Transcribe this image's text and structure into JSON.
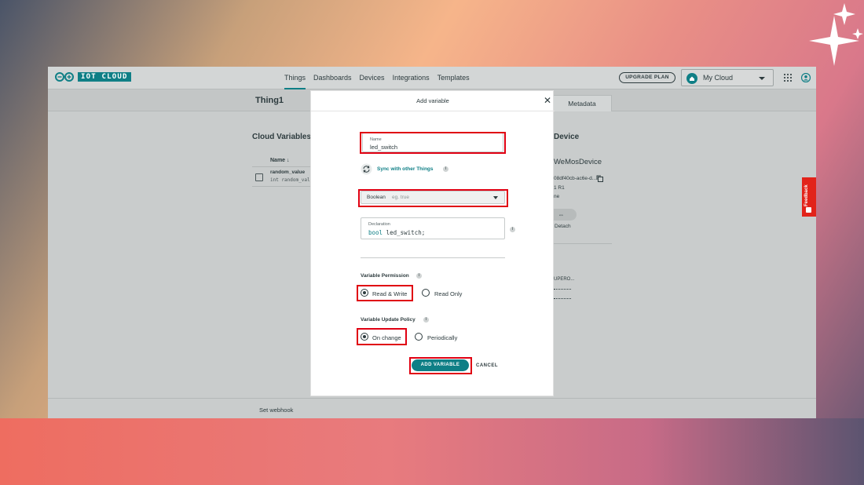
{
  "colors": {
    "accent": "#0f7f86",
    "highlight": "#e00012",
    "feedback": "#e2231a"
  },
  "brand": {
    "logo_text": "IOT CLOUD",
    "logo_icon": "arduino-infinity-icon"
  },
  "nav": {
    "items": [
      "Things",
      "Dashboards",
      "Devices",
      "Integrations",
      "Templates"
    ],
    "active": "Things"
  },
  "header": {
    "upgrade_label": "UPGRADE PLAN",
    "cloud_label": "My Cloud"
  },
  "thing": {
    "title": "Thing1",
    "metadata_tab": "Metadata"
  },
  "cloud_variables": {
    "title": "Cloud Variables",
    "column_name": "Name",
    "rows": [
      {
        "name": "random_value",
        "declaration": "int random_value;"
      }
    ]
  },
  "device": {
    "title": "Device",
    "name": "WeMosDevice",
    "id": "08df40cb-ac6e-d...",
    "r1": "1 R1",
    "status": "ne",
    "detach_label": "Detach",
    "other_text": "UPERO..."
  },
  "footer": {
    "webhook_label": "Set webhook"
  },
  "feedback_label": "Feedback",
  "modal": {
    "title": "Add variable",
    "close_label": "✕",
    "name_label": "Name",
    "name_value": "led_switch",
    "sync_label": "Sync with other Things",
    "type_value": "Boolean",
    "type_example": "eg. true",
    "declaration_label": "Declaration",
    "declaration_keyword": "bool",
    "declaration_rest": " led_switch;",
    "permission_label": "Variable Permission",
    "permission_options": [
      "Read & Write",
      "Read Only"
    ],
    "permission_selected": "Read & Write",
    "policy_label": "Variable Update Policy",
    "policy_options": [
      "On change",
      "Periodically"
    ],
    "policy_selected": "On change",
    "add_label": "ADD VARIABLE",
    "cancel_label": "CANCEL"
  }
}
